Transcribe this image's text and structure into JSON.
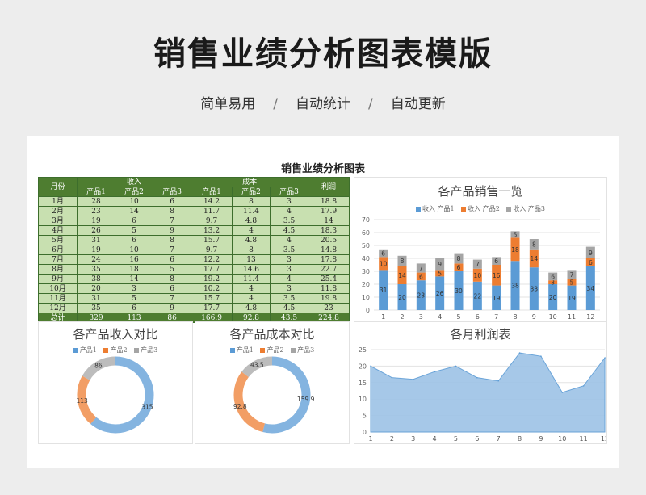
{
  "header": {
    "title": "销售业绩分析图表模版",
    "tags": [
      "简单易用",
      "自动统计",
      "自动更新"
    ],
    "separator": "/"
  },
  "sheet_title": "销售业绩分析图表",
  "table": {
    "group_headers": {
      "month": "月份",
      "income": "收入",
      "cost": "成本",
      "profit": "利润"
    },
    "sub_headers": [
      "产品1",
      "产品2",
      "产品3",
      "产品1",
      "产品2",
      "产品3"
    ],
    "rows": [
      [
        "1月",
        "28",
        "10",
        "6",
        "14.2",
        "8",
        "3",
        "18.8"
      ],
      [
        "2月",
        "23",
        "14",
        "8",
        "11.7",
        "11.4",
        "4",
        "17.9"
      ],
      [
        "3月",
        "19",
        "6",
        "7",
        "9.7",
        "4.8",
        "3.5",
        "14"
      ],
      [
        "4月",
        "26",
        "5",
        "9",
        "13.2",
        "4",
        "4.5",
        "18.3"
      ],
      [
        "5月",
        "31",
        "6",
        "8",
        "15.7",
        "4.8",
        "4",
        "20.5"
      ],
      [
        "6月",
        "19",
        "10",
        "7",
        "9.7",
        "8",
        "3.5",
        "14.8"
      ],
      [
        "7月",
        "24",
        "16",
        "6",
        "12.2",
        "13",
        "3",
        "17.8"
      ],
      [
        "8月",
        "35",
        "18",
        "5",
        "17.7",
        "14.6",
        "3",
        "22.7"
      ],
      [
        "9月",
        "38",
        "14",
        "8",
        "19.2",
        "11.4",
        "4",
        "25.4"
      ],
      [
        "10月",
        "20",
        "3",
        "6",
        "10.2",
        "4",
        "3",
        "11.8"
      ],
      [
        "11月",
        "31",
        "5",
        "7",
        "15.7",
        "4",
        "3.5",
        "19.8"
      ],
      [
        "12月",
        "35",
        "6",
        "9",
        "17.7",
        "4.8",
        "4.5",
        "23"
      ]
    ],
    "total": [
      "总计",
      "329",
      "113",
      "86",
      "166.9",
      "92.8",
      "43.5",
      "224.8"
    ]
  },
  "colors": {
    "p1": "#5b9bd5",
    "p2": "#ed7d31",
    "p3": "#a5a5a5",
    "area": "#9dc3e6",
    "green": "#4e7d30"
  },
  "legend_labels": {
    "p1": "收入 产品1",
    "p2": "收入 产品2",
    "p3": "收入 产品3"
  },
  "donut_legend_labels": {
    "p1": "产品1",
    "p2": "产品2",
    "p3": "产品3"
  },
  "chart_data": [
    {
      "type": "bar",
      "stacked": true,
      "title": "各产品销售一览",
      "categories": [
        "1",
        "2",
        "3",
        "4",
        "5",
        "6",
        "7",
        "8",
        "9",
        "10",
        "11",
        "12"
      ],
      "series": [
        {
          "name": "收入 产品1",
          "values": [
            31,
            20,
            23,
            26,
            30,
            22,
            19,
            38,
            33,
            20,
            19,
            34
          ]
        },
        {
          "name": "收入 产品2",
          "values": [
            10,
            14,
            6,
            5,
            6,
            10,
            16,
            18,
            14,
            3,
            5,
            6
          ]
        },
        {
          "name": "收入 产品3",
          "values": [
            6,
            8,
            7,
            9,
            8,
            7,
            6,
            5,
            8,
            6,
            7,
            9
          ]
        }
      ],
      "ylim": [
        0,
        70
      ],
      "yticks": [
        0,
        10,
        20,
        30,
        40,
        50,
        60,
        70
      ],
      "legend": "top",
      "grid": true
    },
    {
      "type": "pie",
      "donut": true,
      "title": "各产品收入对比",
      "categories": [
        "产品1",
        "产品2",
        "产品3"
      ],
      "values": [
        315,
        113,
        86
      ],
      "legend": "top"
    },
    {
      "type": "pie",
      "donut": true,
      "title": "各产品成本对比",
      "categories": [
        "产品1",
        "产品2",
        "产品3"
      ],
      "values": [
        159.9,
        92.8,
        43.5
      ],
      "legend": "top"
    },
    {
      "type": "area",
      "title": "各月利润表",
      "categories": [
        "1",
        "2",
        "3",
        "4",
        "5",
        "6",
        "7",
        "8",
        "9",
        "10",
        "11",
        "12"
      ],
      "values": [
        20,
        16.5,
        16,
        18.3,
        20,
        16.5,
        15.5,
        24,
        23,
        12,
        14,
        22.5
      ],
      "ylim": [
        0,
        25
      ],
      "yticks": [
        0,
        5,
        10,
        15,
        20,
        25
      ],
      "grid": true
    }
  ]
}
